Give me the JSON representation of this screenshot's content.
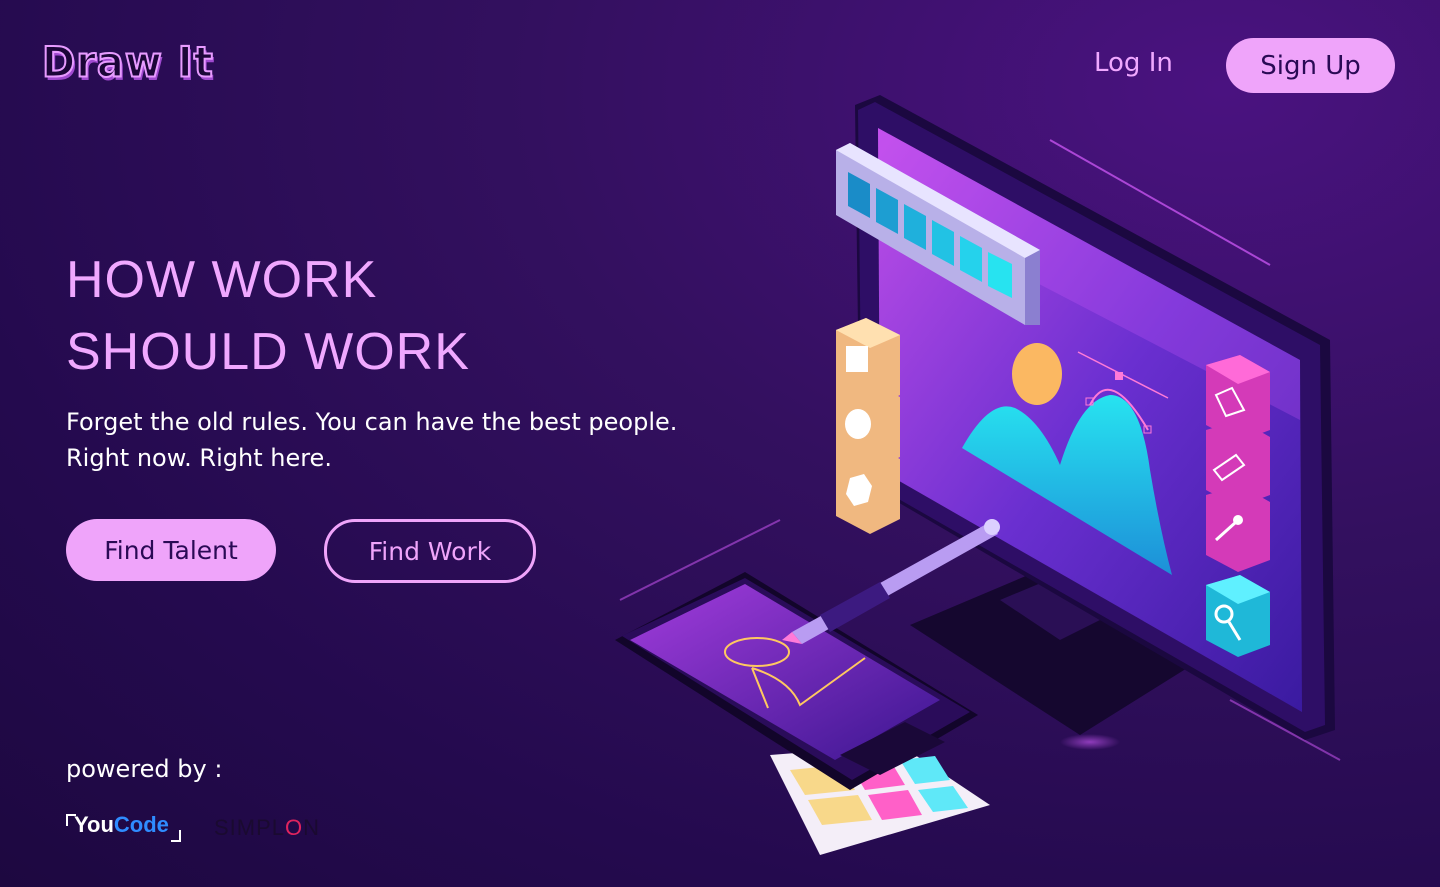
{
  "brand": {
    "logo_text": "Draw It"
  },
  "nav": {
    "login_label": "Log In",
    "signup_label": "Sign Up"
  },
  "hero": {
    "title_line1": "HOW WORK",
    "title_line2": "SHOULD WORK",
    "subtitle_line1": "Forget the old rules. You can have the best people.",
    "subtitle_line2": "Right now. Right here."
  },
  "actions": {
    "find_talent_label": "Find Talent",
    "find_work_label": "Find Work"
  },
  "footer": {
    "powered_by": "powered by :",
    "partner1_a": "You",
    "partner1_b": "Code",
    "partner2_a": "SIMPL",
    "partner2_b": "O",
    "partner2_c": "N"
  },
  "colors": {
    "accent": "#efa4fa",
    "background": "#2a0b55",
    "highlight_cyan": "#27e3f0"
  },
  "icons": [
    "pen-tool-icon",
    "eraser-icon",
    "dropper-icon",
    "magnifier-icon",
    "square-icon",
    "circle-icon",
    "hexagon-icon"
  ]
}
